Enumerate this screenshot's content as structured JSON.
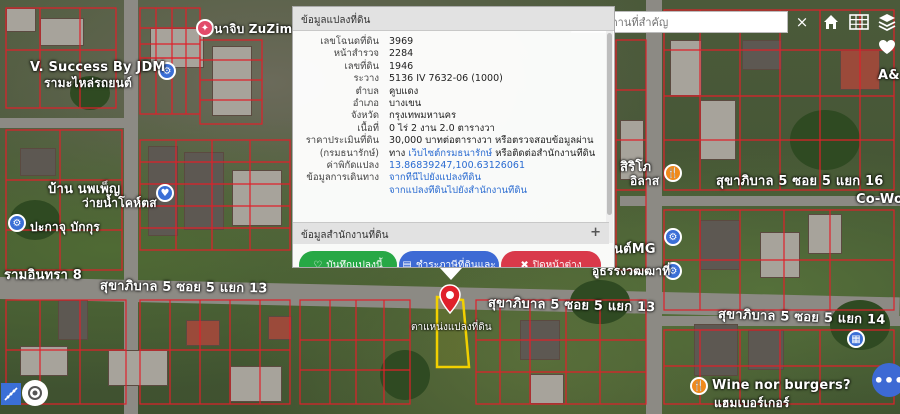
{
  "map": {
    "labels": {
      "zuzim": "นาจิบ ZuZim",
      "vsuccess_1": "V. Success By JDM",
      "vsuccess_2": "รามะไหล่รถยนต์",
      "ban_poeng_1": "บ้าน นพเพ็ญ",
      "ban_poeng_2": "ว่ายน้ำโคห์ตส",
      "pakkhu": "ปะกาจุ บักกุร",
      "ram_indra": "รามอินทรา 8",
      "sukhapiban_left": "สุขาภิบาล 5 ซอย 5 แยก 13",
      "sukhapiban_mid": "สุขาภิบาล 5 ซอย 5 แยก 13",
      "sukhapiban_right_top": "สุขาภิบาล 5 ซอย 5 แยก 16",
      "sukhapiban_right_bot": "สุขาภิบาล 5 ซอย 5 แยก 14",
      "co_work": "Co-Wor",
      "mg": "นต์MG",
      "sirinthorn": "สิริโภ",
      "sirinthorn2": "อิลาส",
      "kuwatit": "อู่ธรรงวฒฒาที่",
      "wine": "Wine nor burgers?",
      "wine2": "แฮมเบอร์เกอร์",
      "aplus": "A&",
      "parcel_label": "ตาแหน่งแปลงที่ดิน"
    }
  },
  "search": {
    "placeholder": "ค้นหาสถานที่สำคัญ",
    "clear": "×"
  },
  "panel": {
    "title": "ข้อมูลแปลงที่ดิน",
    "rows": [
      {
        "label": "เลขโฉนดที่ดิน",
        "value": "3969"
      },
      {
        "label": "หน้าสำรวจ",
        "value": "2284"
      },
      {
        "label": "เลขที่ดิน",
        "value": "1946"
      },
      {
        "label": "ระวาง",
        "value": "5136 IV 7632-06 (1000)"
      },
      {
        "label": "ตำบล",
        "value": "คูบแดง"
      },
      {
        "label": "อำเภอ",
        "value": "บางเขน"
      },
      {
        "label": "จังหวัด",
        "value": "กรุงเทพมหานคร"
      },
      {
        "label": "เนื้อที่",
        "value": "0 ไร่ 2 งาน 2.0 ตารางวา"
      },
      {
        "label": "ราคาประเมินที่ดิน",
        "value": "30,000 บาทต่อตารางวา หรือตรวจสอบข้อมูลผ่าน"
      },
      {
        "label": "(กรมธนารักษ์)",
        "value_prefix": "ทาง",
        "value_link": "เว็บไซต์กรมธนารักษ์",
        "value_suffix": "หรือติดต่อสำนักงานที่ดิน"
      },
      {
        "label": "ค่าพิกัดแปลง",
        "value_link": "13.86839247,100.63126061"
      },
      {
        "label": "ข้อมูลการเดินทาง",
        "value_link": "จากที่นี่ไปยังแปลงที่ดิน"
      },
      {
        "label": "",
        "value_link": "จากแปลงที่ดินไปยังสำนักงานที่ดิน"
      }
    ],
    "section2_title": "ข้อมูลสำนักงานที่ดิน",
    "section2_toggle": "+",
    "buttons": {
      "save": "บันทึกแปลงนี้",
      "tax": "ชำระภาษีที่ดินและ",
      "close": "ปิดหน้าต่าง"
    }
  },
  "colors": {
    "parcel_lines": "#e0202a",
    "selected_parcel": "#f2d000",
    "accent_blue": "#3d6ad4",
    "save_green": "#27a845",
    "close_red": "#d9394a"
  },
  "fab": {
    "label": "•••"
  }
}
